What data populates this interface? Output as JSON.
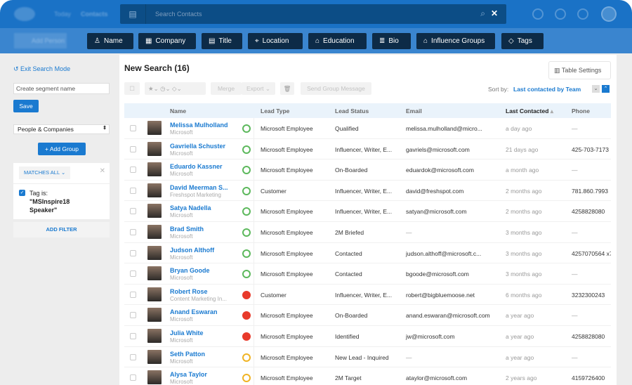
{
  "nav": {
    "today": "Today",
    "contacts": "Contacts",
    "add_person": "Add Person"
  },
  "search": {
    "placeholder": "Search Contacts",
    "close": "✕"
  },
  "filters": [
    {
      "label": "Name",
      "icon": "person-icon"
    },
    {
      "label": "Company",
      "icon": "building-icon"
    },
    {
      "label": "Title",
      "icon": "calendar-icon"
    },
    {
      "label": "Location",
      "icon": "pin-icon"
    },
    {
      "label": "Education",
      "icon": "graduation-cap-icon"
    },
    {
      "label": "Bio",
      "icon": "document-icon"
    },
    {
      "label": "Influence Groups",
      "icon": "group-icon"
    },
    {
      "label": "Tags",
      "icon": "tag-icon"
    }
  ],
  "sidebar": {
    "exit": "Exit Search Mode",
    "segment_placeholder": "Create segment name",
    "save": "Save",
    "scope": "People & Companies",
    "add_group": "+ Add Group",
    "matches": "MATCHES ALL",
    "tag_label": "Tag is:",
    "tag_value": "\"MSInspire18 Speaker\"",
    "add_filter": "ADD FILTER"
  },
  "main": {
    "title": "New Search (16)",
    "table_settings": "Table Settings",
    "merge": "Merge",
    "export": "Export",
    "send": "Send Group Message",
    "sort_label": "Sort by:",
    "sort_value": "Last contacted by Team"
  },
  "columns": {
    "name": "Name",
    "lead_type": "Lead Type",
    "lead_status": "Lead Status",
    "email": "Email",
    "last": "Last Contacted",
    "phone": "Phone"
  },
  "colors": {
    "green": "#5cb85c",
    "red": "#e83a2b",
    "yellow": "#f0b323",
    "accent": "#1a7ad0"
  },
  "rows": [
    {
      "name": "Melissa Mulholland",
      "company": "Microsoft",
      "status_color": "green",
      "type": "Microsoft Employee",
      "status": "Qualified",
      "email": "melissa.mulholland@micro...",
      "last": "a day ago",
      "phone": "—"
    },
    {
      "name": "Gavriella Schuster",
      "company": "Microsoft",
      "status_color": "green",
      "type": "Microsoft Employee",
      "status": "Influencer, Writer, E...",
      "email": "gavriels@microsoft.com",
      "last": "21 days ago",
      "phone": "425-703-7173"
    },
    {
      "name": "Eduardo Kassner",
      "company": "Microsoft",
      "status_color": "green",
      "type": "Microsoft Employee",
      "status": "On-Boarded",
      "email": "eduardok@microsoft.com",
      "last": "a month ago",
      "phone": "—"
    },
    {
      "name": "David Meerman S...",
      "company": "Freshspot Marketing",
      "status_color": "green",
      "type": "Customer",
      "status": "Influencer, Writer, E...",
      "email": "david@freshspot.com",
      "last": "2 months ago",
      "phone": "781.860.7993"
    },
    {
      "name": "Satya Nadella",
      "company": "Microsoft",
      "status_color": "green",
      "type": "Microsoft Employee",
      "status": "Influencer, Writer, E...",
      "email": "satyan@microsoft.com",
      "last": "2 months ago",
      "phone": "4258828080"
    },
    {
      "name": "Brad Smith",
      "company": "Microsoft",
      "status_color": "green",
      "type": "Microsoft Employee",
      "status": "2M Briefed",
      "email": "—",
      "last": "3 months ago",
      "phone": "—"
    },
    {
      "name": "Judson Althoff",
      "company": "Microsoft",
      "status_color": "green",
      "type": "Microsoft Employee",
      "status": "Contacted",
      "email": "judson.althoff@microsoft.c...",
      "last": "3 months ago",
      "phone": "4257070564 x7"
    },
    {
      "name": "Bryan Goode",
      "company": "Microsoft",
      "status_color": "green",
      "type": "Microsoft Employee",
      "status": "Contacted",
      "email": "bgoode@microsoft.com",
      "last": "3 months ago",
      "phone": "—"
    },
    {
      "name": "Robert Rose",
      "company": "Content Marketing In...",
      "status_color": "red",
      "type": "Customer",
      "status": "Influencer, Writer, E...",
      "email": "robert@bigbluemoose.net",
      "last": "6 months ago",
      "phone": "3232300243"
    },
    {
      "name": "Anand Eswaran",
      "company": "Microsoft",
      "status_color": "red",
      "type": "Microsoft Employee",
      "status": "On-Boarded",
      "email": "anand.eswaran@microsoft.com",
      "last": "a year ago",
      "phone": "—"
    },
    {
      "name": "Julia White",
      "company": "Microsoft",
      "status_color": "red",
      "type": "Microsoft Employee",
      "status": "Identified",
      "email": "jw@microsoft.com",
      "last": "a year ago",
      "phone": "4258828080"
    },
    {
      "name": "Seth Patton",
      "company": "Microsoft",
      "status_color": "yellow",
      "type": "Microsoft Employee",
      "status": "New Lead - Inquired",
      "email": "—",
      "last": "a year ago",
      "phone": "—"
    },
    {
      "name": "Alysa Taylor",
      "company": "Microsoft",
      "status_color": "yellow",
      "type": "Microsoft Employee",
      "status": "2M Target",
      "email": "ataylor@microsoft.com",
      "last": "2 years ago",
      "phone": "4159726400"
    }
  ]
}
